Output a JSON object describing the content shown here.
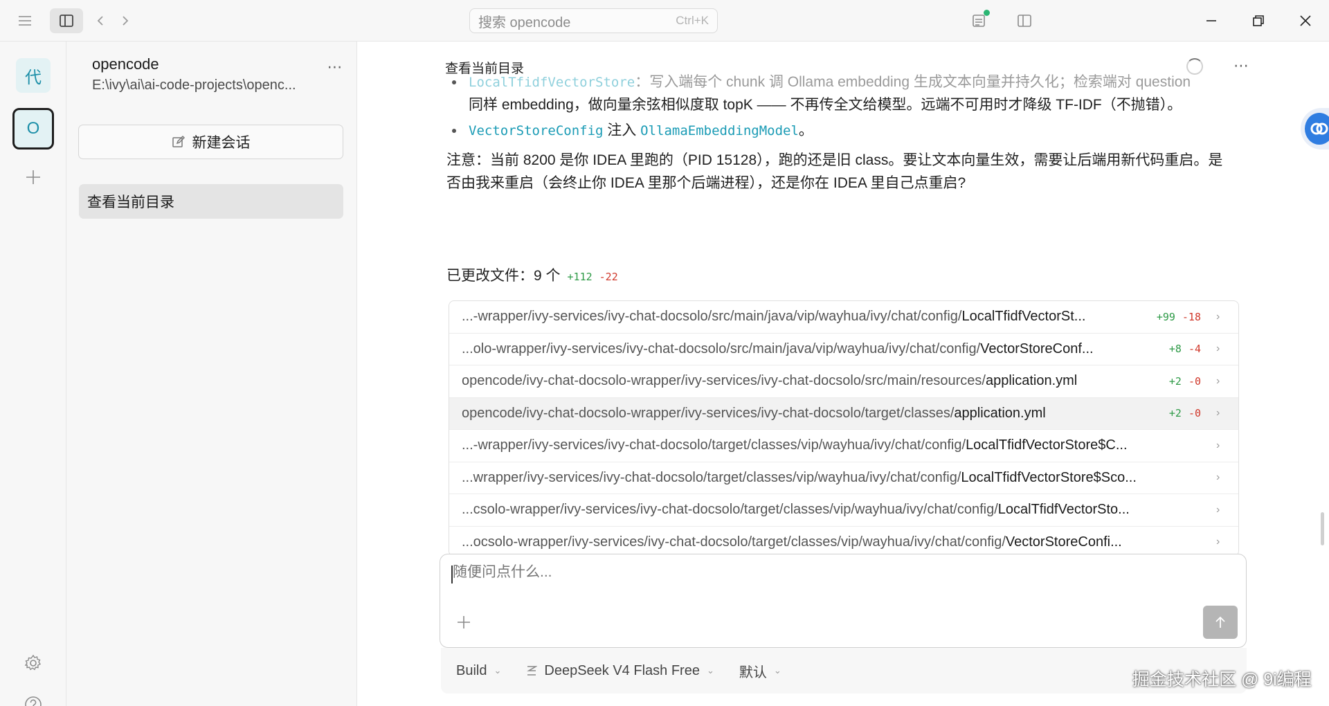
{
  "titlebar": {
    "search_placeholder": "搜索 opencode",
    "search_shortcut": "Ctrl+K"
  },
  "rail": {
    "project_a_label": "代",
    "project_b_label": "O"
  },
  "sessions": {
    "project_name": "opencode",
    "project_path": "E:\\ivy\\ai\\ai-code-projects\\openc...",
    "new_session_label": "新建会话",
    "items": [
      {
        "label": "查看当前目录"
      }
    ]
  },
  "chat": {
    "title": "查看当前目录",
    "bullet1": {
      "code": "LocalTfidfVectorStore",
      "line1": "：写入端每个 chunk 调 Ollama embedding 生成文本向量并持久化；检索端对 question",
      "line2": "同样 embedding，做向量余弦相似度取 topK —— 不再传全文给模型。远端不可用时才降级 TF-IDF（不抛错）。"
    },
    "bullet2": {
      "code1": "VectorStoreConfig",
      "text": " 注入 ",
      "code2": "OllamaEmbeddingModel",
      "tail": "。"
    },
    "note_line1": "注意：当前 8200 是你 IDEA 里跑的（PID 15128），跑的还是旧 class。要让文本向量生效，需要让后端用新代码重启。是",
    "note_line2": "否由我来重启（会终止你 IDEA 里那个后端进程），还是你在 IDEA 里自己点重启?",
    "changed": {
      "label": "已更改文件：9 个",
      "added": "+112",
      "removed": "-22"
    },
    "files": [
      {
        "dir": "...-wrapper/ivy-services/ivy-chat-docsolo/src/main/java/vip/wayhua/ivy/chat/config/",
        "name": "LocalTfidfVectorSt...",
        "added": "+99",
        "removed": "-18"
      },
      {
        "dir": "...olo-wrapper/ivy-services/ivy-chat-docsolo/src/main/java/vip/wayhua/ivy/chat/config/",
        "name": "VectorStoreConf...",
        "added": "+8",
        "removed": "-4"
      },
      {
        "dir": "opencode/ivy-chat-docsolo-wrapper/ivy-services/ivy-chat-docsolo/src/main/resources/",
        "name": "application.yml",
        "added": "+2",
        "removed": "-0"
      },
      {
        "dir": "opencode/ivy-chat-docsolo-wrapper/ivy-services/ivy-chat-docsolo/target/classes/",
        "name": "application.yml",
        "added": "+2",
        "removed": "-0"
      },
      {
        "dir": "...-wrapper/ivy-services/ivy-chat-docsolo/target/classes/vip/wayhua/ivy/chat/config/",
        "name": "LocalTfidfVectorStore$C...",
        "added": "",
        "removed": ""
      },
      {
        "dir": "...wrapper/ivy-services/ivy-chat-docsolo/target/classes/vip/wayhua/ivy/chat/config/",
        "name": "LocalTfidfVectorStore$Sco...",
        "added": "",
        "removed": ""
      },
      {
        "dir": "...csolo-wrapper/ivy-services/ivy-chat-docsolo/target/classes/vip/wayhua/ivy/chat/config/",
        "name": "LocalTfidfVectorSto...",
        "added": "",
        "removed": ""
      },
      {
        "dir": "...ocsolo-wrapper/ivy-services/ivy-chat-docsolo/target/classes/vip/wayhua/ivy/chat/config/",
        "name": "VectorStoreConfi...",
        "added": "",
        "removed": ""
      }
    ]
  },
  "composer": {
    "placeholder": "随便问点什么..."
  },
  "bottom_bar": {
    "agent": "Build",
    "model": "DeepSeek V4 Flash Free",
    "variant": "默认"
  },
  "watermark": "掘金技术社区 @ 9i编程",
  "colors": {
    "accent": "#1c8fa8",
    "code": "#1a9bb5",
    "added": "#2e9a47",
    "removed": "#d0382b",
    "status_dot": "#2bb673"
  }
}
